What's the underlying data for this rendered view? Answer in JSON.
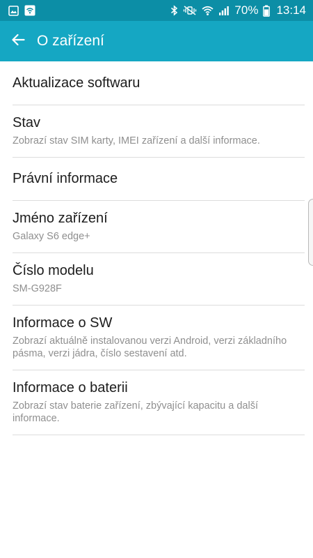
{
  "status_bar": {
    "battery_percent": "70%",
    "time": "13:14",
    "icons_left": [
      "gallery-notification-icon",
      "wifi-hotspot-notification-icon"
    ],
    "icons_right": [
      "bluetooth-icon",
      "vibrate-mute-icon",
      "wifi-icon",
      "signal-icon",
      "battery-icon"
    ]
  },
  "header": {
    "title": "O zařízení",
    "back_icon": "arrow-left-icon"
  },
  "settings": {
    "items": [
      {
        "title": "Aktualizace softwaru",
        "subtitle": ""
      },
      {
        "title": "Stav",
        "subtitle": "Zobrazí stav SIM karty, IMEI zařízení a další informace."
      },
      {
        "title": "Právní informace",
        "subtitle": ""
      },
      {
        "title": "Jméno zařízení",
        "subtitle": "Galaxy S6 edge+"
      },
      {
        "title": "Číslo modelu",
        "subtitle": "SM-G928F"
      },
      {
        "title": "Informace o SW",
        "subtitle": "Zobrazí aktuálně instalovanou verzi Android, verzi základního pásma, verzi jádra, číslo sestavení atd."
      },
      {
        "title": "Informace o baterii",
        "subtitle": "Zobrazí stav baterie zařízení, zbývající kapacitu a další informace."
      }
    ]
  },
  "colors": {
    "status_bar": "#0c8ea6",
    "action_bar": "#15a7c3",
    "text_primary": "#1c1c1c",
    "text_secondary": "#8f8f8f",
    "divider": "#dcdcdc"
  }
}
